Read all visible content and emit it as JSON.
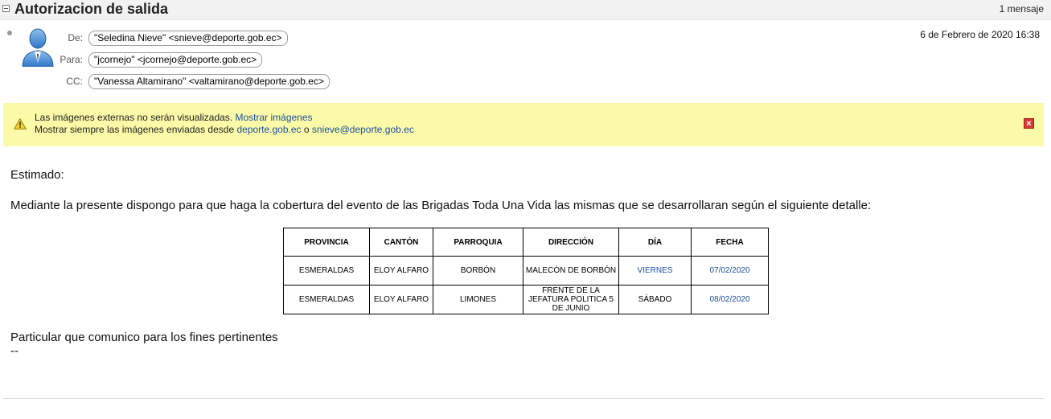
{
  "header": {
    "subject": "Autorizacion de salida",
    "message_count": "1 mensaje"
  },
  "message": {
    "from_label": "De:",
    "from": "\"Seledina Nieve\" <snieve@deporte.gob.ec>",
    "to_label": "Para:",
    "to": "\"jcornejo\" <jcornejo@deporte.gob.ec>",
    "cc_label": "CC:",
    "cc": "\"Vanessa Altamirano\" <valtamirano@deporte.gob.ec>",
    "date": "6 de Febrero de 2020 16:38"
  },
  "warning": {
    "line1_text": "Las imágenes externas no serán visualizadas.",
    "line1_link": "Mostrar imágenes",
    "line2_text": "Mostrar siempre las imágenes enviadas desde",
    "line2_link1": "deporte.gob.ec",
    "line2_or": "o",
    "line2_link2": "snieve@deporte.gob.ec"
  },
  "body": {
    "greeting": "Estimado:",
    "intro": "Mediante la presente dispongo para que haga la cobertura del evento de las Brigadas Toda Una Vida las mismas que se desarrollaran según el siguiente detalle:",
    "closing": "Particular que comunico para los fines pertinentes",
    "signature": "--"
  },
  "table": {
    "headers": [
      "PROVINCIA",
      "CANTÓN",
      "PARROQUIA",
      "DIRECCIÓN",
      "DÍA",
      "FECHA"
    ],
    "rows": [
      [
        "ESMERALDAS",
        "ELOY ALFARO",
        "BORBÓN",
        "MALECÓN DE BORBÓN",
        "VIERNES",
        "07/02/2020"
      ],
      [
        "ESMERALDAS",
        "ELOY ALFARO",
        "LIMONES",
        "FRENTE DE LA JEFATURA POLITICA 5 DE JUNIO",
        "SÁBADO",
        "08/02/2020"
      ]
    ]
  },
  "colors": {
    "link": "#1d4fa0",
    "warning_bg": "#fbfaa8",
    "close_button": "#d63a3a"
  },
  "icons": {
    "collapse": "collapse-icon",
    "avatar": "user-avatar-icon",
    "warning": "warning-triangle-icon",
    "close": "close-icon"
  }
}
